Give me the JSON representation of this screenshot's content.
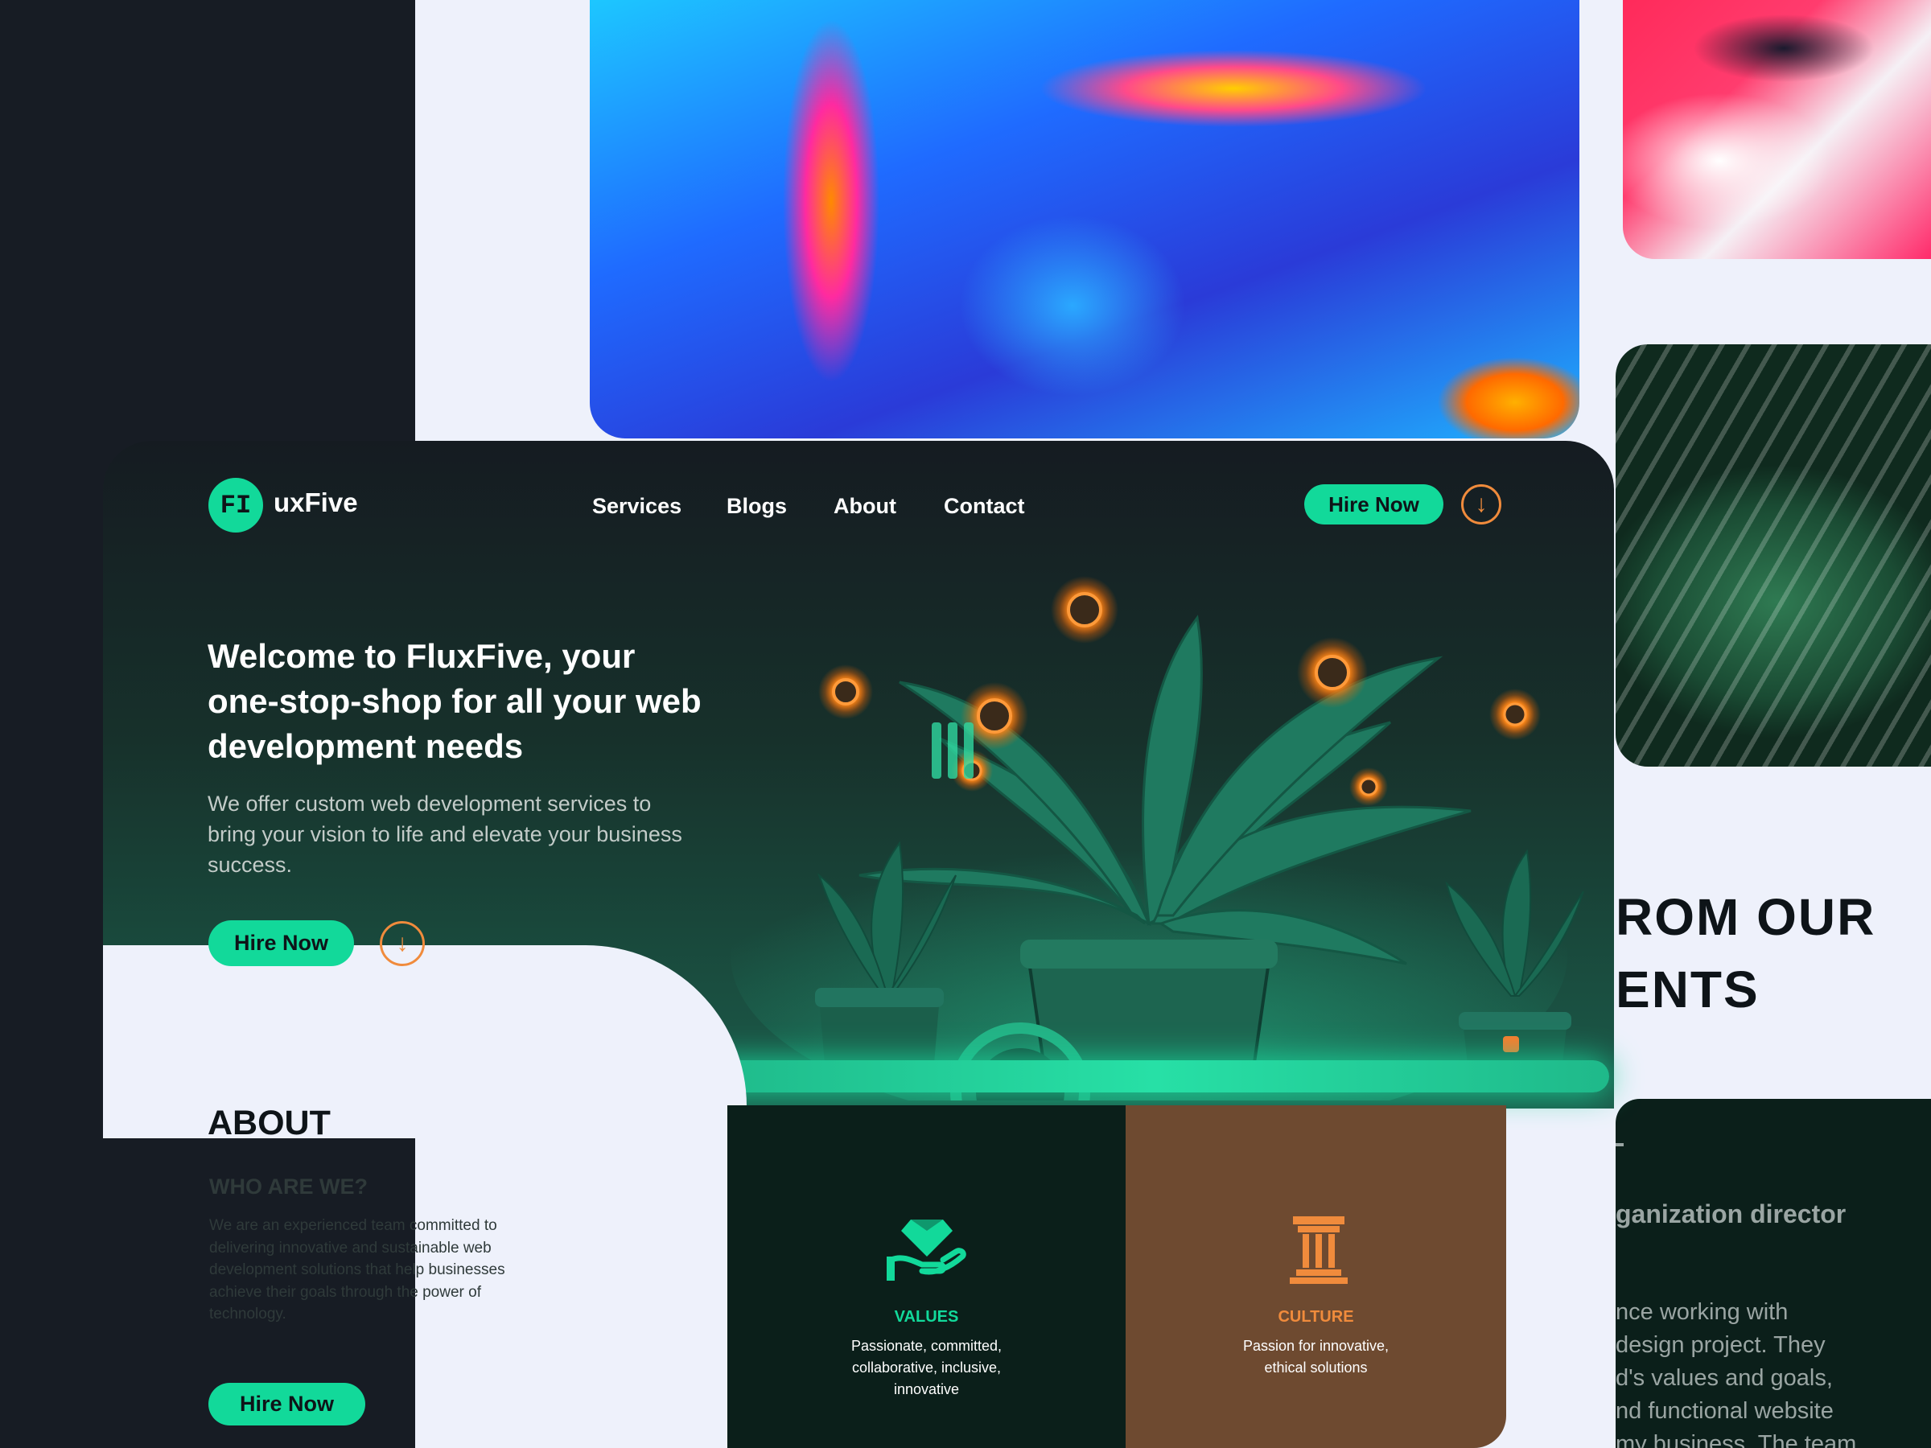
{
  "brand": {
    "logo_mark": "FI",
    "name": "uxFive"
  },
  "nav": {
    "items": [
      {
        "label": "Services"
      },
      {
        "label": "Blogs"
      },
      {
        "label": "About"
      },
      {
        "label": "Contact"
      }
    ],
    "hire_label": "Hire Now"
  },
  "hero": {
    "title": "Welcome to FluxFive, your\none-stop-shop for all your web\ndevelopment needs",
    "subtitle": "We offer custom web development services to\nbring your vision to life and elevate your business\nsuccess.",
    "hire_label": "Hire Now"
  },
  "about": {
    "title": "ABOUT",
    "subtitle": "WHO ARE WE?",
    "body": "We are an experienced team committed to\ndelivering innovative and sustainable web\ndevelopment solutions that help businesses\nachieve their goals through the power of\ntechnology.",
    "hire_label": "Hire Now"
  },
  "values": {
    "title": "VALUES",
    "body": "Passionate, committed,\ncollaborative, inclusive,\ninnovative"
  },
  "culture": {
    "title": "CULTURE",
    "body": "Passion for innovative,\nethical solutions"
  },
  "testimonials": {
    "heading": "ROM OUR\nENTS",
    "role": "ganization director",
    "body": "nce working with\ndesign project. They\nd's values and goals,\nnd functional website\nmy business. The team"
  },
  "colors": {
    "accent": "#12d99a",
    "orange": "#f08b3c",
    "dark": "#171c24",
    "culture_brown": "#6e4a30",
    "values_dark": "#0b1f1a",
    "canvas": "#eef1fb"
  },
  "icons": {
    "arrow": "arrow-down-circle-icon",
    "values": "diamond-hand-icon",
    "culture": "pillar-icon"
  }
}
